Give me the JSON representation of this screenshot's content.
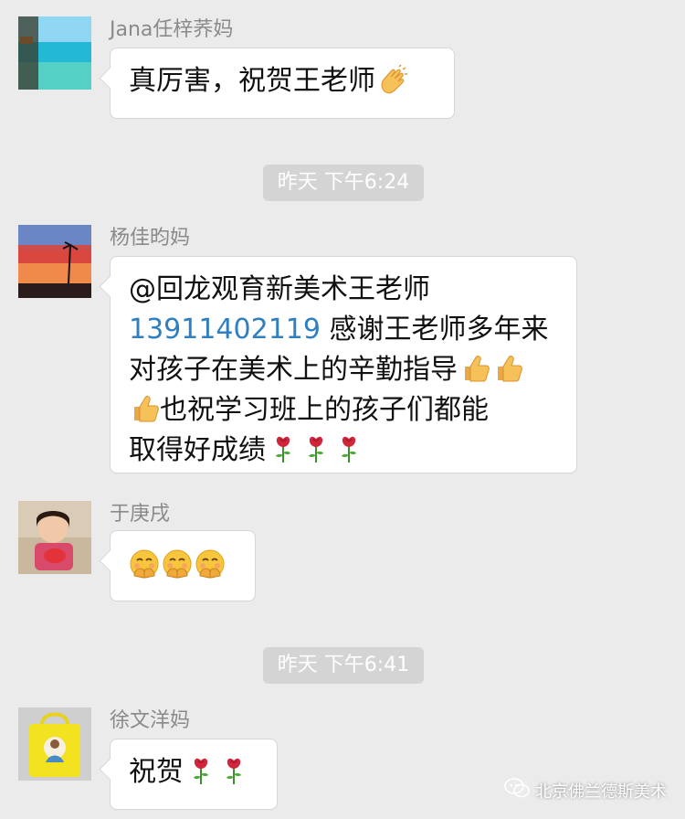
{
  "messages": [
    {
      "sender": "Jana任梓荞妈",
      "avatar": "tropical-beach-avatar",
      "text": "真厉害，祝贺王老师",
      "emoji": "clapping-hands-icon"
    },
    {
      "sender": "杨佳昀妈",
      "avatar": "sunset-palm-avatar",
      "line1": "@回龙观育新美术王老师",
      "phone": "13911402119",
      "line2_rest": " 感谢王老师多年来",
      "line3": "对孩子在美术上的辛勤指导",
      "line4": "也祝学习班上的孩子们都能",
      "line5": "取得好成绩"
    },
    {
      "sender": "于庚戌",
      "avatar": "child-photo-avatar"
    },
    {
      "sender": "徐文洋妈",
      "avatar": "yellow-bag-avatar",
      "text": "祝贺"
    }
  ],
  "timestamps": [
    "昨天 下午6:24",
    "昨天 下午6:41"
  ],
  "watermark": "北京佛兰德斯美术",
  "colors": {
    "background": "#ebebeb",
    "bubble": "#ffffff",
    "phone_link": "#2f7fc1",
    "timestamp_bg": "#d4d4d4"
  }
}
